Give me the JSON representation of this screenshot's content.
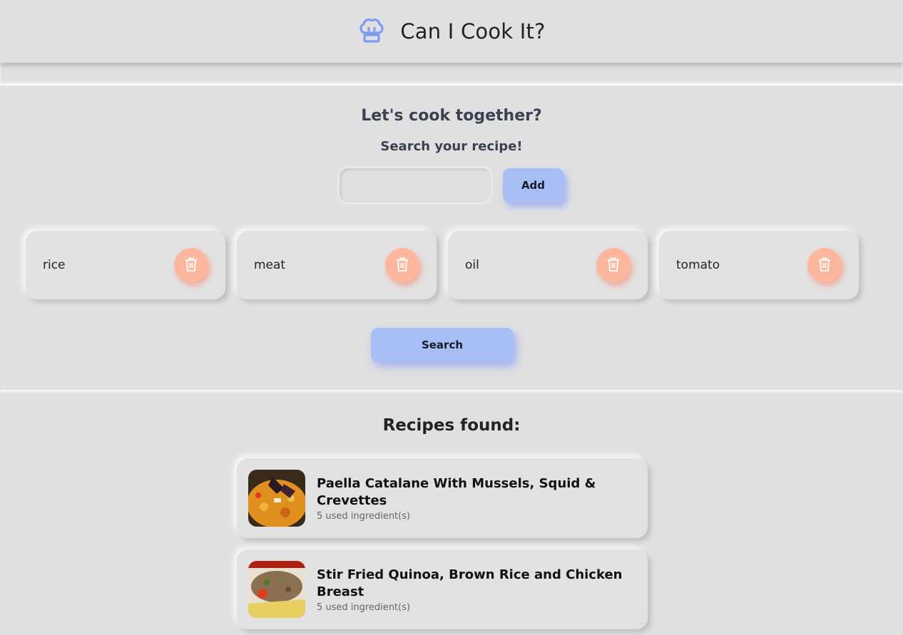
{
  "app": {
    "title": "Can I Cook It?",
    "logo_icon": "chef-hat-icon",
    "accent_color": "#7d9bf2"
  },
  "search": {
    "heading": "Let's cook together?",
    "subheading": "Search your recipe!",
    "input_value": "",
    "input_placeholder": "",
    "add_label": "Add",
    "search_label": "Search"
  },
  "ingredients": [
    {
      "label": "rice",
      "delete_icon": "trash-icon"
    },
    {
      "label": "meat",
      "delete_icon": "trash-icon"
    },
    {
      "label": "oil",
      "delete_icon": "trash-icon"
    },
    {
      "label": "tomato",
      "delete_icon": "trash-icon"
    }
  ],
  "results": {
    "title": "Recipes found:",
    "recipes": [
      {
        "name": "Paella Catalane With Mussels, Squid & Crevettes",
        "meta": "5 used ingredient(s)"
      },
      {
        "name": "Stir Fried Quinoa, Brown Rice and Chicken Breast",
        "meta": "5 used ingredient(s)"
      }
    ]
  }
}
